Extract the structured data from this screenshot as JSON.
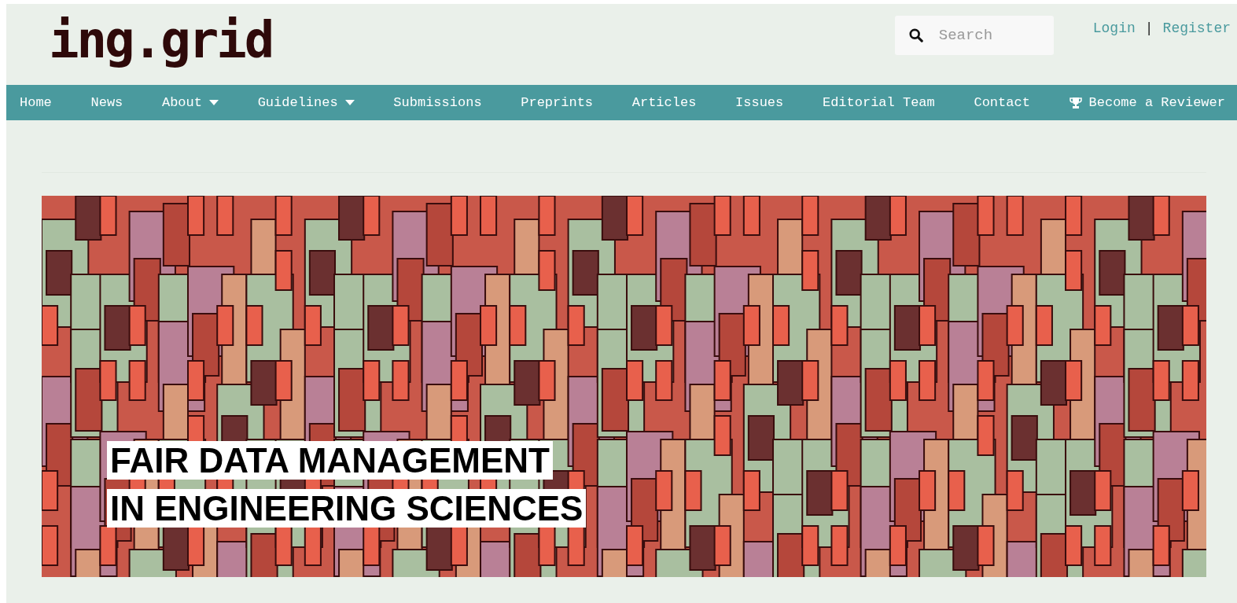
{
  "logo": {
    "text": "ing.grid"
  },
  "search": {
    "placeholder": "Search"
  },
  "user_links": [
    {
      "label": "Login"
    },
    {
      "label": "Register"
    }
  ],
  "user_links_separator": "|",
  "nav": [
    {
      "label": "Home",
      "kind": "link",
      "dropdown": false
    },
    {
      "label": "News",
      "kind": "link",
      "dropdown": false
    },
    {
      "label": "About",
      "kind": "link",
      "dropdown": true
    },
    {
      "label": "Guidelines",
      "kind": "link",
      "dropdown": true
    },
    {
      "label": "Submissions",
      "kind": "link",
      "dropdown": false
    },
    {
      "label": "Preprints",
      "kind": "link",
      "dropdown": false
    },
    {
      "label": "Articles",
      "kind": "link",
      "dropdown": false
    },
    {
      "label": "Issues",
      "kind": "link",
      "dropdown": false
    },
    {
      "label": "Editorial Team",
      "kind": "link",
      "dropdown": false
    },
    {
      "label": "Contact",
      "kind": "link",
      "dropdown": false
    },
    {
      "label": "Become a Reviewer",
      "kind": "trophy",
      "dropdown": false
    }
  ],
  "banner": {
    "title_lines": [
      "FAIR DATA MANAGEMENT",
      "IN ENGINEERING SCIENCES"
    ]
  }
}
